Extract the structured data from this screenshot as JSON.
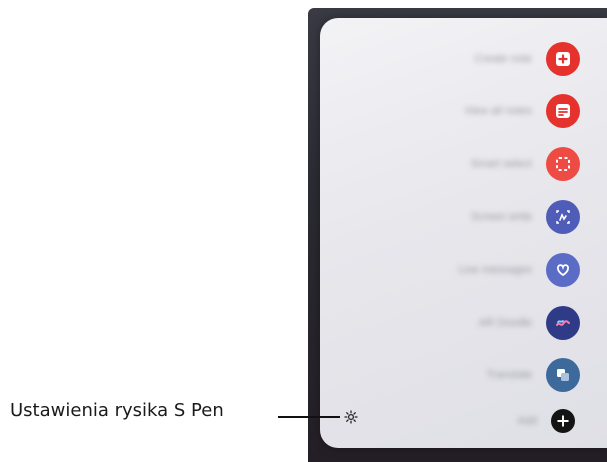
{
  "callout": {
    "settings_label": "Ustawienia rysika S Pen"
  },
  "menu": {
    "items": [
      {
        "label": "Create note",
        "icon": "create-note-icon",
        "color": "#e5322d"
      },
      {
        "label": "View all notes",
        "icon": "view-all-notes-icon",
        "color": "#e5322d"
      },
      {
        "label": "Smart select",
        "icon": "smart-select-icon",
        "color": "#ef4b45"
      },
      {
        "label": "Screen write",
        "icon": "screen-write-icon",
        "color": "#4f5db8"
      },
      {
        "label": "Live messages",
        "icon": "live-messages-icon",
        "color": "#5b6cc6"
      },
      {
        "label": "AR Doodle",
        "icon": "ar-doodle-icon",
        "color": "#2f3b86"
      },
      {
        "label": "Translate",
        "icon": "translate-icon",
        "color": "#3d6a9b"
      },
      {
        "label": "Add",
        "icon": "add-icon",
        "color": "#141414"
      }
    ]
  },
  "colors": {
    "device_bg": "#2b2b33",
    "panel_bg": "#ececf0",
    "accent_red": "#e5322d",
    "accent_blue": "#4f5db8"
  }
}
